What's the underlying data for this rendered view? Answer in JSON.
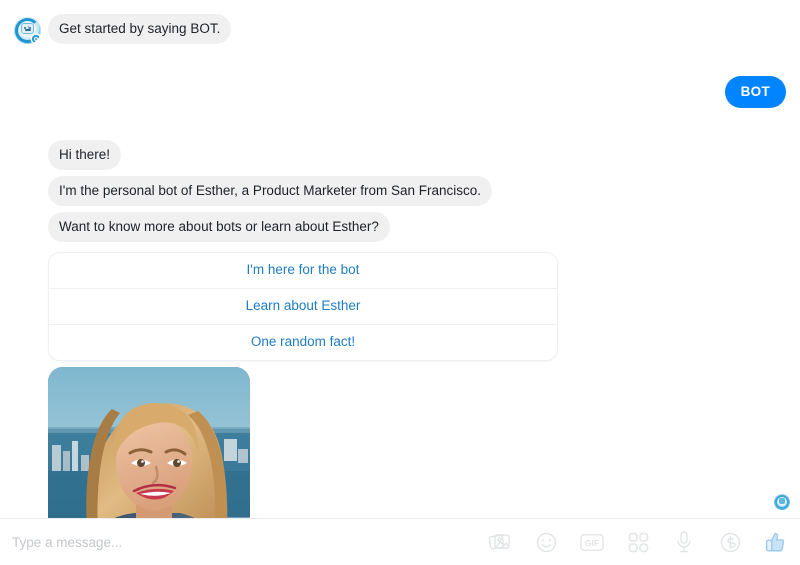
{
  "app": {
    "name": "messenger-chat",
    "accent_color": "#0084ff",
    "incoming_bubble_color": "#f1f0f0",
    "link_color": "#1f7dc4"
  },
  "conversation": {
    "messages": [
      {
        "id": "m1",
        "direction": "incoming",
        "show_avatar": true,
        "text": "Get started by saying BOT."
      },
      {
        "id": "m2",
        "direction": "outgoing",
        "show_avatar": false,
        "text": "BOT"
      },
      {
        "id": "m3",
        "direction": "incoming",
        "show_avatar": false,
        "text": "Hi there!"
      },
      {
        "id": "m4",
        "direction": "incoming",
        "show_avatar": false,
        "text": "I'm the personal bot of Esther, a Product Marketer from San Francisco."
      },
      {
        "id": "m5",
        "direction": "incoming",
        "show_avatar": false,
        "text": "Want to know more about bots or learn about Esther?"
      }
    ],
    "quick_replies": [
      {
        "id": "qr1",
        "label": "I'm here for the bot"
      },
      {
        "id": "qr2",
        "label": "Learn about Esther"
      },
      {
        "id": "qr3",
        "label": "One random fact!"
      }
    ],
    "attachment": {
      "type": "photo",
      "alt": "Portrait photo of a smiling blonde woman outdoors by the sea"
    },
    "avatar": {
      "name": "bot-avatar",
      "alt": "Bot profile picture"
    },
    "status": {
      "name": "seen-indicator",
      "alt": "Delivered"
    }
  },
  "composer": {
    "placeholder": "Type a message...",
    "value": "",
    "tools": [
      {
        "id": "t1",
        "icon": "photo-icon",
        "label": "Send a photo"
      },
      {
        "id": "t2",
        "icon": "emoji-icon",
        "label": "Choose an emoji"
      },
      {
        "id": "t3",
        "icon": "gif-icon",
        "label": "GIF"
      },
      {
        "id": "t4",
        "icon": "apps-icon",
        "label": "Apps"
      },
      {
        "id": "t5",
        "icon": "microphone-icon",
        "label": "Record a voice clip"
      },
      {
        "id": "t6",
        "icon": "payment-icon",
        "label": "Send money"
      },
      {
        "id": "t7",
        "icon": "thumbs-up-icon",
        "label": "Send a like"
      }
    ]
  }
}
